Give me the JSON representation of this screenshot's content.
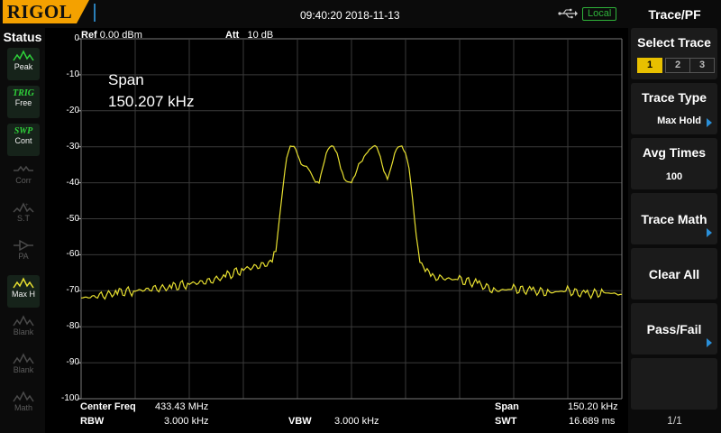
{
  "brand": "RIGOL",
  "datetime": "09:40:20 2018-11-13",
  "remote_status": "Local",
  "status_panel": {
    "title": "Status",
    "items": [
      {
        "label": "Peak",
        "icon": "peak-icon",
        "state": "active"
      },
      {
        "header": "TRIG",
        "label": "Free",
        "icon": "trig-text-icon",
        "state": "active"
      },
      {
        "header": "SWP",
        "label": "Cont",
        "icon": "sweep-text-icon",
        "state": "active"
      },
      {
        "label": "Corr",
        "icon": "corr-icon",
        "state": "inactive"
      },
      {
        "label": "S.T",
        "icon": "source-tracking-icon",
        "state": "inactive"
      },
      {
        "label": "PA",
        "icon": "preamp-icon",
        "state": "inactive"
      },
      {
        "label": "Max H",
        "icon": "max-hold-icon",
        "state": "active"
      },
      {
        "label": "Blank",
        "icon": "trace-blank-icon",
        "state": "inactive"
      },
      {
        "label": "Blank",
        "icon": "trace-blank-icon",
        "state": "inactive"
      },
      {
        "label": "Math",
        "icon": "trace-math-icon",
        "state": "inactive"
      }
    ]
  },
  "plot": {
    "ref_label": "Ref",
    "ref_value": "0.00 dBm",
    "att_label": "Att",
    "att_value": "10 dB",
    "marker_line1": "Span",
    "marker_line2": "150.207 kHz",
    "trace_color": "#e8e030",
    "grid_color": "#3a3a3a",
    "y_ticks": [
      "0",
      "-10",
      "-20",
      "-30",
      "-40",
      "-50",
      "-60",
      "-70",
      "-80",
      "-90",
      "-100"
    ]
  },
  "chart_data": {
    "type": "line",
    "ylim": [
      -100,
      0
    ],
    "xlim": [
      -75.1,
      75.1
    ],
    "x_unit": "kHz offset from center",
    "y_unit": "dBm",
    "grid": true,
    "series": [
      {
        "x": [
          -75.1,
          -70,
          -65,
          -60,
          -55,
          -50,
          -45,
          -40,
          -35,
          -30,
          -25,
          -22,
          -21,
          -20,
          -19,
          -18,
          -17,
          -16,
          -15,
          -14,
          -13,
          -12,
          -11,
          -10,
          -9,
          -8,
          -7,
          -6,
          -5,
          -4,
          -3,
          -2,
          -1,
          0,
          1,
          2,
          3,
          4,
          5,
          6,
          7,
          8,
          9,
          10,
          11,
          12,
          13,
          14,
          15,
          16,
          17,
          18,
          19,
          20,
          21,
          22,
          25,
          30,
          35,
          40,
          45,
          50,
          55,
          60,
          65,
          70,
          75.1
        ],
        "y": [
          -72,
          -71.5,
          -70.5,
          -70,
          -69.5,
          -69,
          -68,
          -67.5,
          -66,
          -64,
          -63,
          -62,
          -59,
          -50,
          -41,
          -33,
          -30,
          -30,
          -32,
          -35,
          -35.5,
          -36,
          -38,
          -40,
          -40,
          -36,
          -32,
          -30,
          -30,
          -32,
          -36,
          -39,
          -40,
          -40,
          -38,
          -35,
          -34,
          -32,
          -31,
          -30,
          -30,
          -33,
          -37,
          -39,
          -36,
          -32,
          -30,
          -30,
          -32,
          -36,
          -45,
          -55,
          -62,
          -64,
          -65,
          -66,
          -66.5,
          -67,
          -68,
          -70,
          -69.5,
          -70,
          -70.5,
          -70,
          -71,
          -70.5,
          -71
        ]
      }
    ]
  },
  "bottom": {
    "center_freq_label": "Center Freq",
    "center_freq_value": "433.43 MHz",
    "span_label": "Span",
    "span_value": "150.20 kHz",
    "rbw_label": "RBW",
    "rbw_value": "3.000 kHz",
    "vbw_label": "VBW",
    "vbw_value": "3.000 kHz",
    "swt_label": "SWT",
    "swt_value": "16.689 ms"
  },
  "softkeys": {
    "title": "Trace/PF",
    "select_trace": {
      "label": "Select Trace",
      "options": [
        "1",
        "2",
        "3"
      ],
      "selected": "1"
    },
    "trace_type": {
      "label": "Trace Type",
      "value": "Max Hold"
    },
    "avg_times": {
      "label": "Avg Times",
      "value": "100"
    },
    "trace_math": {
      "label": "Trace Math"
    },
    "clear_all": {
      "label": "Clear All"
    },
    "pass_fail": {
      "label": "Pass/Fail"
    },
    "page": "1/1"
  }
}
